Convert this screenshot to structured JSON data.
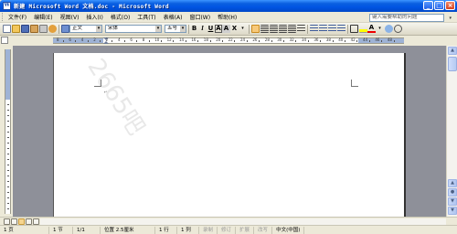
{
  "window": {
    "title": "新建 Microsoft Word 文档.doc - Microsoft Word",
    "minimize_label": "_",
    "maximize_label": "□",
    "close_label": "×"
  },
  "menu": {
    "items": [
      {
        "label": "文件(F)"
      },
      {
        "label": "编辑(E)"
      },
      {
        "label": "视图(V)"
      },
      {
        "label": "插入(I)"
      },
      {
        "label": "格式(O)"
      },
      {
        "label": "工具(T)"
      },
      {
        "label": "表格(A)"
      },
      {
        "label": "窗口(W)"
      },
      {
        "label": "帮助(H)"
      }
    ],
    "help_placeholder": "键入需要帮助的问题"
  },
  "toolbar": {
    "style_value": "正文",
    "font_value": "宋体",
    "size_value": "五号",
    "bold_label": "B",
    "italic_label": "I",
    "underline_label": "U",
    "char_border_label": "A",
    "char_shading_label": "A",
    "scale_label": "X"
  },
  "ruler": {
    "numbers": [
      "8",
      "6",
      "4",
      "2",
      "2",
      "4",
      "6",
      "8",
      "10",
      "12",
      "14",
      "16",
      "18",
      "20",
      "22",
      "24",
      "26",
      "28",
      "30",
      "32",
      "34",
      "36",
      "38",
      "40",
      "42",
      "44",
      "46",
      "48"
    ]
  },
  "document": {
    "paragraph_mark": "↵",
    "watermark": "2665吧"
  },
  "statusbar": {
    "page": "1 页",
    "section": "1 节",
    "page_of": "1/1",
    "position": "位置 2.5厘米",
    "line": "1 行",
    "column": "1 列",
    "rec": "录制",
    "trk": "修订",
    "ext": "扩展",
    "ovr": "改写",
    "language": "中文(中国)"
  }
}
